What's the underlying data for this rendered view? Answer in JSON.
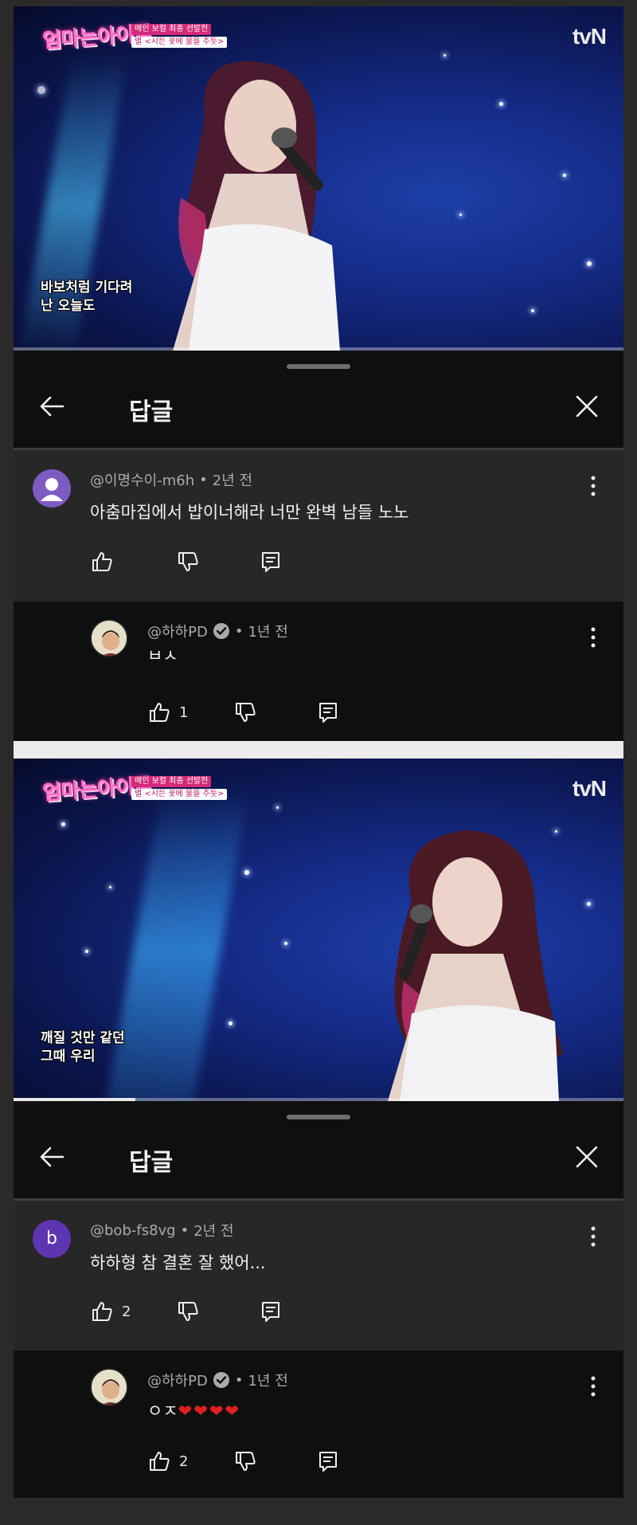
{
  "screens": [
    {
      "video": {
        "show_logo": "엄마는아이돌",
        "show_info_line1": "메인 보컬 최종 선발전",
        "show_info_line2": "별 <시든 꽃에 물을 주듯>",
        "channel": "tvN",
        "caption_line1": "바보처럼 기다려",
        "caption_line2": "난 오늘도",
        "progress": 0
      },
      "header": {
        "title": "답글"
      },
      "comment": {
        "avatar_letter": "",
        "handle": "@이명수이-m6h",
        "time": "2년 전",
        "text": "아춤마집에서 밥이너해라 너만 완벽 남들 노노",
        "like_count": ""
      },
      "reply": {
        "handle": "@하하PD",
        "verified": true,
        "time": "1년 전",
        "text": "ㅂㅅ",
        "like_count": "1"
      }
    },
    {
      "video": {
        "show_logo": "엄마는아이돌",
        "show_info_line1": "메인 보컬 최종 선발전",
        "show_info_line2": "별 <시든 꽃에 물을 주듯>",
        "channel": "tvN",
        "caption_line1": "깨질 것만 같던",
        "caption_line2": "그때 우리",
        "progress": 0.2
      },
      "header": {
        "title": "답글"
      },
      "comment": {
        "avatar_letter": "b",
        "handle": "@bob-fs8vg",
        "time": "2년 전",
        "text": "하하형 참 결혼 잘 했어...",
        "like_count": "2"
      },
      "reply": {
        "handle": "@하하PD",
        "verified": true,
        "time": "1년 전",
        "text": "ㅇㅈ",
        "hearts": "❤❤❤❤",
        "like_count": "2"
      }
    }
  ],
  "icons": {
    "back": "arrow-left-icon",
    "close": "close-icon",
    "like": "thumbs-up-icon",
    "dislike": "thumbs-down-icon",
    "reply": "reply-icon",
    "more": "more-vert-icon",
    "verified": "verified-check-icon"
  },
  "colors": {
    "page_bg": "#2a2a2a",
    "header_bg": "#0f0f0f",
    "comment_bg": "#272727",
    "reply_bg": "#0f0f0f",
    "avatar_purple": "#5e35b1",
    "hearts": "#e02020"
  }
}
